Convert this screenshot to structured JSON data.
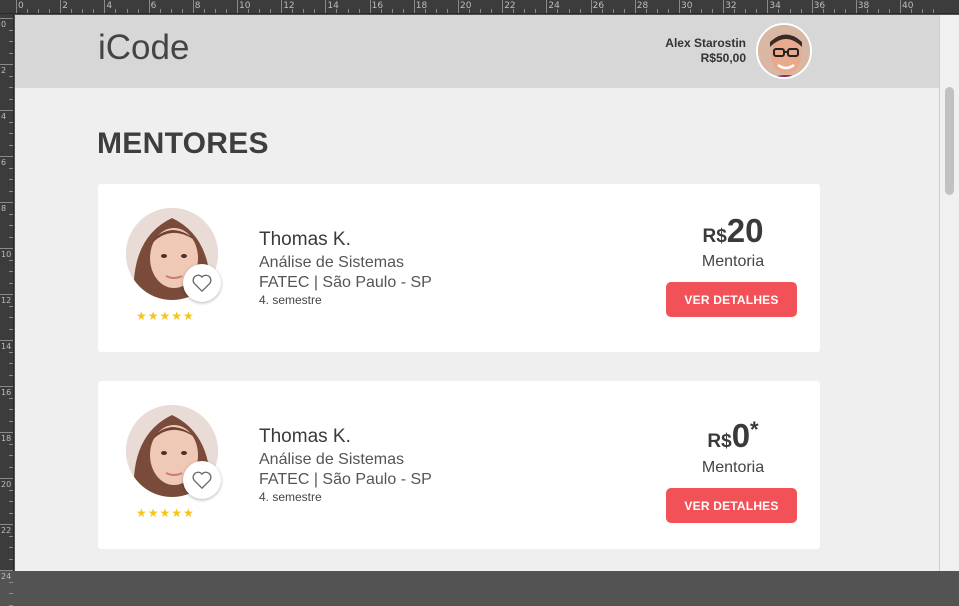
{
  "ruler": {
    "top_labels": [
      "0",
      "2",
      "4",
      "6",
      "8",
      "10",
      "12",
      "14",
      "16",
      "18",
      "20",
      "22",
      "24",
      "26",
      "28",
      "30",
      "32",
      "34",
      "36",
      "38",
      "40"
    ],
    "left_labels": [
      "0",
      "2",
      "4",
      "6",
      "8",
      "10",
      "12",
      "14",
      "16",
      "18",
      "20",
      "22",
      "24"
    ]
  },
  "header": {
    "logo": "iCode",
    "user_name": "Alex Starostin",
    "balance": "R$50,00"
  },
  "page_title": "MENTORES",
  "mentors": [
    {
      "name": "Thomas K.",
      "course": "Análise de Sistemas",
      "school": "FATEC  | São Paulo - SP",
      "semester": "4. semestre",
      "rating": "★★★★★",
      "currency": "R$",
      "price": "20",
      "price_note": "",
      "price_type": "Mentoria",
      "button_label": "VER DETALHES"
    },
    {
      "name": "Thomas K.",
      "course": "Análise de Sistemas",
      "school": "FATEC  | São Paulo - SP",
      "semester": "4. semestre",
      "rating": "★★★★★",
      "currency": "R$",
      "price": "0",
      "price_note": "*",
      "price_type": "Mentoria",
      "button_label": "VER DETALHES"
    }
  ],
  "colors": {
    "accent": "#f25157",
    "star": "#f5c518",
    "header_bg": "#d7d7d7",
    "page_bg": "#efefef"
  },
  "icons": {
    "favorite": "heart-outline-icon",
    "rating": "star-icon"
  }
}
